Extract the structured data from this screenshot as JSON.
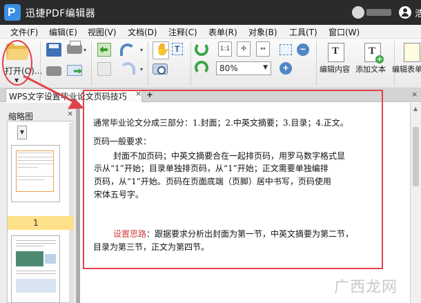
{
  "titlebar": {
    "title": "迅捷PDF编辑器",
    "user_initial": "浩"
  },
  "menu": [
    "文件(F)",
    "编辑(E)",
    "视图(V)",
    "文档(D)",
    "注释(C)",
    "表单(R)",
    "对象(B)",
    "工具(T)",
    "窗口(W)"
  ],
  "toolbar": {
    "open_label": "打开(O)...",
    "zoom_value": "80%",
    "edit_content_label": "编辑内容",
    "add_text_label": "添加文本",
    "edit_form_label": "编辑表单"
  },
  "tabs": {
    "document_tab": "WPS文字设置毕业论文页码技巧",
    "close": "×",
    "add": "+"
  },
  "thumbnails": {
    "title": "缩略图",
    "close": "×",
    "page1_number": "1"
  },
  "document": {
    "line1": "通常毕业论文分成三部分：1.封面；2.中英文摘要；3.目录；4.正文。",
    "line2": "页码一般要求：",
    "para1_line1": "封面不加页码；中英文摘要合在一起排页码，用罗马数字格式显",
    "para1_line2": "示从“1”开始；目录单独排页码，从“1”开始；正文需要单独编排",
    "para1_line3": "页码，从“1”开始。页码在页面底端（页脚）居中书写，页码使用",
    "para1_line4": "宋体五号字。",
    "para2_lead": "设置思路",
    "para2_line1_rest": "：跟据要求分析出封面为第一节，中英文摘要为第二节，",
    "para2_line2": "目录为第三节，正文为第四节。"
  },
  "watermark": "广西龙网",
  "colors": {
    "annotation_red": "#e0424a",
    "titlebar_bg": "#2b2b2b",
    "highlight_yellow": "#ffe08a"
  }
}
